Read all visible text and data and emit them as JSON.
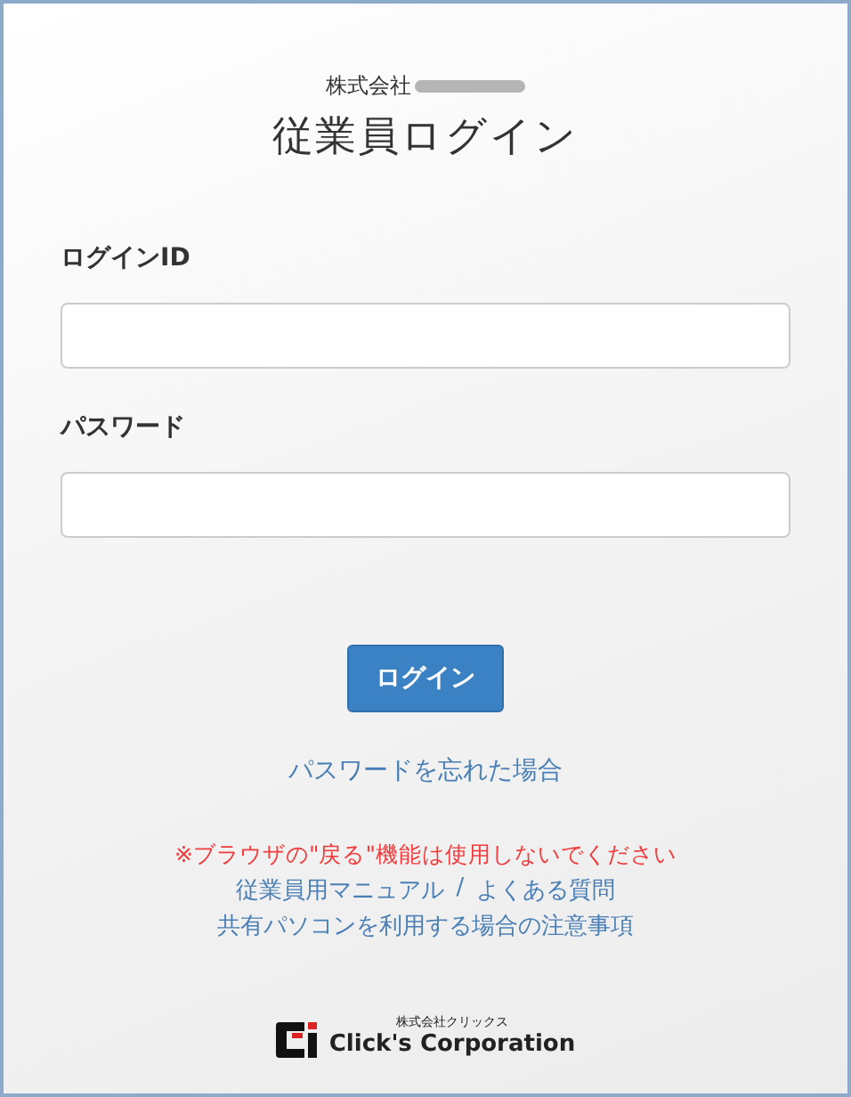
{
  "header": {
    "company_prefix": "株式会社",
    "title": "従業員ログイン"
  },
  "fields": [
    {
      "label": "ログインID"
    },
    {
      "label": "パスワード"
    }
  ],
  "login_button": "ログイン",
  "forgot_link": "パスワードを忘れた場合",
  "warning": "※ブラウザの\"戻る\"機能は使用しないでください",
  "help_links": [
    "従業員用マニュアル",
    "よくある質問"
  ],
  "link_separator": "/",
  "notice_link": "共有パソコンを利用する場合の注意事項",
  "logo": {
    "subtitle": "株式会社クリックス",
    "name": "Click's Corporation"
  }
}
